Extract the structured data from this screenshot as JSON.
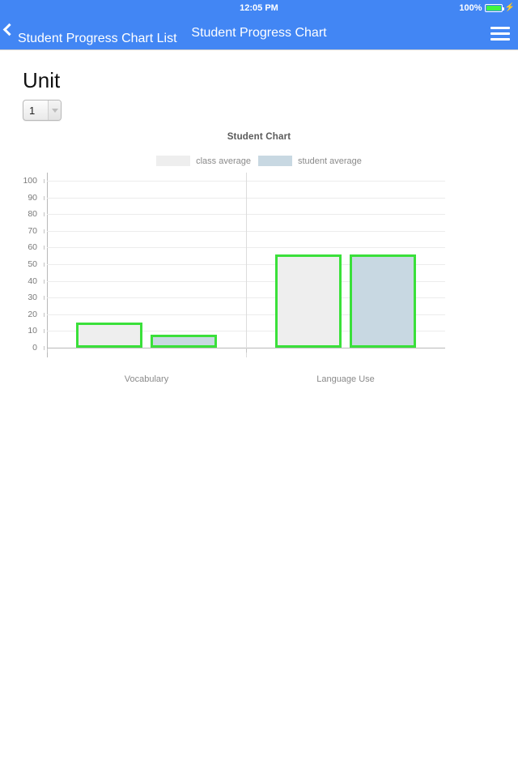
{
  "status_bar": {
    "time": "12:05 PM",
    "battery_percent": "100%",
    "battery_icon": "battery-full-icon",
    "charging_icon": "lightning-bolt-icon"
  },
  "nav_bar": {
    "back_label": "Student Progress Chart List",
    "back_icon": "chevron-left-icon",
    "title": "Student Progress Chart",
    "menu_icon": "hamburger-menu-icon",
    "background_color": "#4286f4"
  },
  "form": {
    "unit_heading": "Unit",
    "unit_value": "1",
    "unit_caret_icon": "chevron-down-icon"
  },
  "chart_data": {
    "type": "bar",
    "title": "Student Chart",
    "categories": [
      "Vocabulary",
      "Language Use"
    ],
    "series": [
      {
        "name": "class average",
        "values": [
          15,
          56
        ],
        "color": "#eeeeee"
      },
      {
        "name": "student average",
        "values": [
          8,
          56
        ],
        "color": "#c8d8e2"
      }
    ],
    "xlabel": "",
    "ylabel": "",
    "ylim": [
      0,
      100
    ],
    "yticks": [
      0,
      10,
      20,
      30,
      40,
      50,
      60,
      70,
      80,
      90,
      100
    ],
    "grid": true,
    "legend_position": "top",
    "bar_border_color": "#3ae03a"
  }
}
